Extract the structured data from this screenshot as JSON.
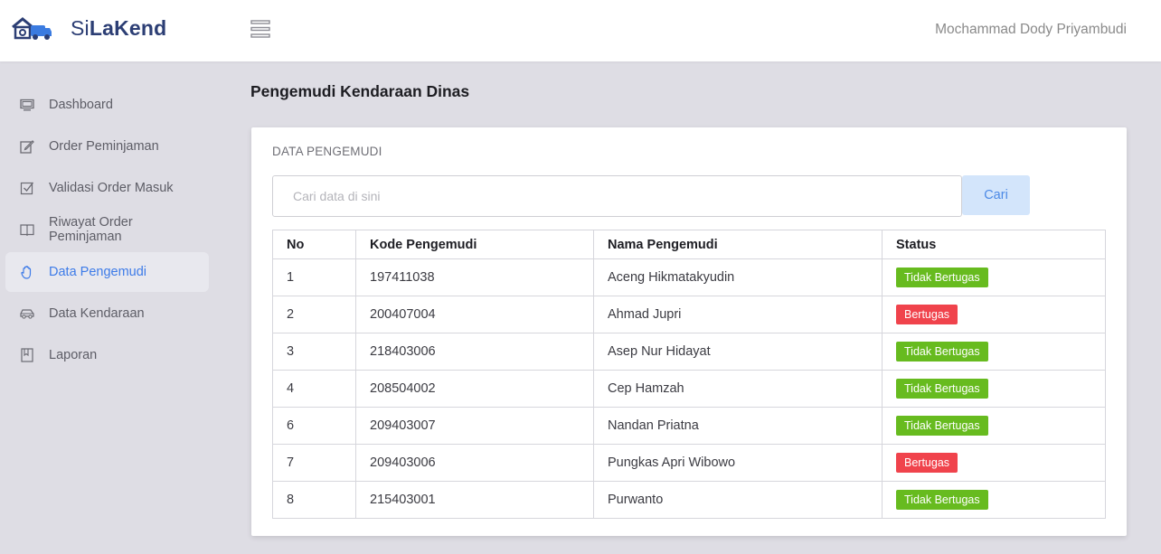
{
  "app": {
    "brand_prefix": "Si",
    "brand_bold": "LaKend",
    "user_name": "Mochammad Dody Priyambudi"
  },
  "sidebar": {
    "items": [
      {
        "label": "Dashboard",
        "icon": "monitor-icon",
        "active": false
      },
      {
        "label": "Order Peminjaman",
        "icon": "edit-icon",
        "active": false
      },
      {
        "label": "Validasi Order Masuk",
        "icon": "checkbox-icon",
        "active": false
      },
      {
        "label": "Riwayat Order Peminjaman",
        "icon": "book-icon",
        "active": false
      },
      {
        "label": "Data Pengemudi",
        "icon": "hand-icon",
        "active": true
      },
      {
        "label": "Data Kendaraan",
        "icon": "car-icon",
        "active": false
      },
      {
        "label": "Laporan",
        "icon": "bookmark-icon",
        "active": false
      }
    ]
  },
  "page": {
    "title": "Pengemudi Kendaraan Dinas"
  },
  "card": {
    "title": "DATA PENGEMUDI",
    "search_placeholder": "Cari data di sini",
    "search_value": "",
    "search_button": "Cari"
  },
  "table": {
    "headers": [
      "No",
      "Kode Pengemudi",
      "Nama Pengemudi",
      "Status"
    ],
    "rows": [
      {
        "no": "1",
        "kode": "197411038",
        "nama": "Aceng Hikmatakyudin",
        "status": "Tidak Bertugas"
      },
      {
        "no": "2",
        "kode": "200407004",
        "nama": "Ahmad Jupri",
        "status": "Bertugas"
      },
      {
        "no": "3",
        "kode": "218403006",
        "nama": "Asep Nur Hidayat",
        "status": "Tidak Bertugas"
      },
      {
        "no": "4",
        "kode": "208504002",
        "nama": "Cep Hamzah",
        "status": "Tidak Bertugas"
      },
      {
        "no": "6",
        "kode": "209403007",
        "nama": "Nandan Priatna",
        "status": "Tidak Bertugas"
      },
      {
        "no": "7",
        "kode": "209403006",
        "nama": "Pungkas Apri Wibowo",
        "status": "Bertugas"
      },
      {
        "no": "8",
        "kode": "215403001",
        "nama": "Purwanto",
        "status": "Tidak Bertugas"
      }
    ]
  },
  "colors": {
    "status_available": "#67bb1f",
    "status_on_duty": "#f0434c",
    "accent": "#3d7be8"
  }
}
